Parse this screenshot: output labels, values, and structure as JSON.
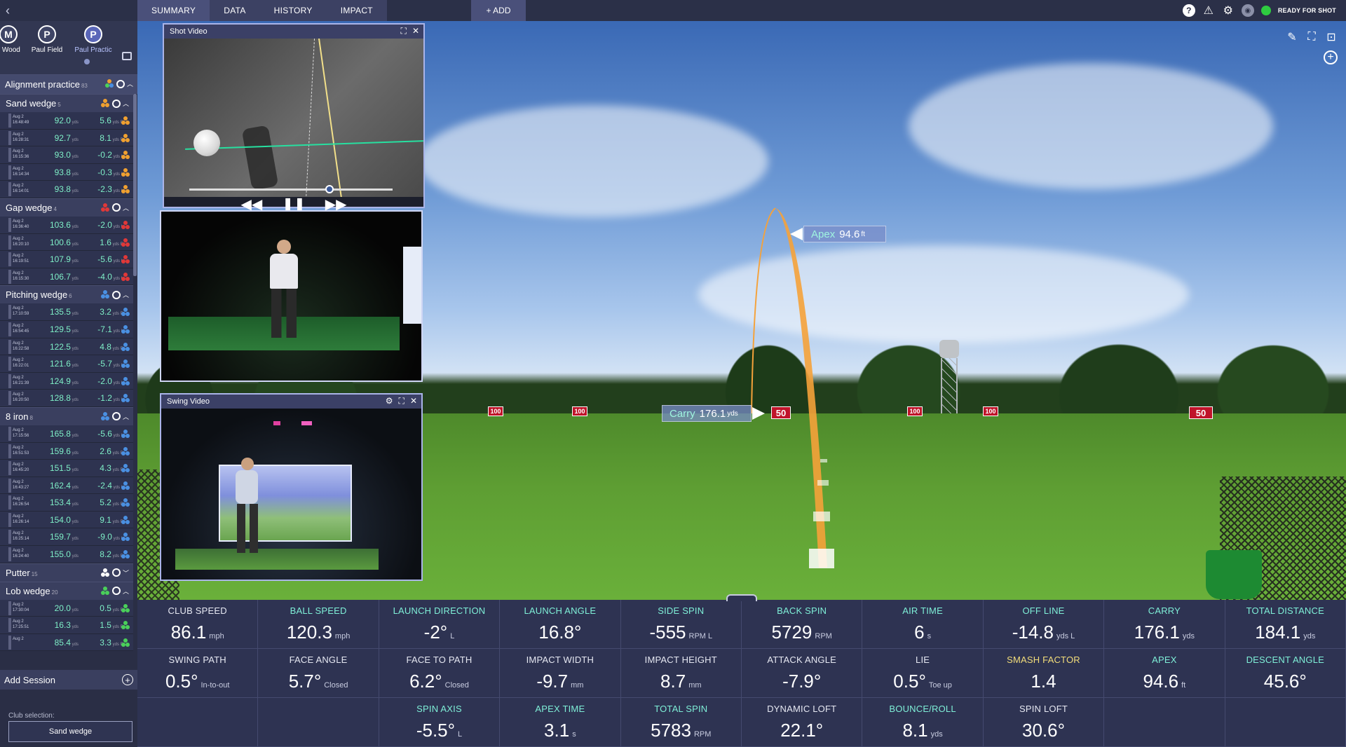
{
  "topbar": {
    "tabs": [
      "SUMMARY",
      "DATA",
      "HISTORY",
      "IMPACT"
    ],
    "add_label": "+ ADD",
    "status": "READY FOR SHOT"
  },
  "sidebar": {
    "profiles": [
      {
        "initial": "M",
        "name": "y Wood"
      },
      {
        "initial": "P",
        "name": "Paul Field"
      },
      {
        "initial": "P",
        "name": "Paul Practic"
      }
    ],
    "session_title": "Alignment practice",
    "session_count": "83",
    "groups": [
      {
        "name": "Sand wedge",
        "count": "5",
        "color": "#f0a030",
        "shots": [
          {
            "date": "Aug 2",
            "time": "16:48:49",
            "carry": "92.0",
            "dev": "5.6",
            "dir": "R"
          },
          {
            "date": "Aug 2",
            "time": "16:28:31",
            "carry": "92.7",
            "dev": "8.1",
            "dir": "R"
          },
          {
            "date": "Aug 2",
            "time": "16:15:36",
            "carry": "93.0",
            "dev": "-0.2",
            "dir": "L"
          },
          {
            "date": "Aug 2",
            "time": "16:14:34",
            "carry": "93.8",
            "dev": "-0.3",
            "dir": "L"
          },
          {
            "date": "Aug 2",
            "time": "16:14:01",
            "carry": "93.8",
            "dev": "-2.3",
            "dir": "L"
          }
        ]
      },
      {
        "name": "Gap wedge",
        "count": "4",
        "color": "#e03838",
        "shots": [
          {
            "date": "Aug 2",
            "time": "16:36:40",
            "carry": "103.6",
            "dev": "-2.0",
            "dir": "L"
          },
          {
            "date": "Aug 2",
            "time": "16:20:10",
            "carry": "100.6",
            "dev": "1.6",
            "dir": "R"
          },
          {
            "date": "Aug 2",
            "time": "16:19:51",
            "carry": "107.9",
            "dev": "-5.6",
            "dir": "L"
          },
          {
            "date": "Aug 2",
            "time": "16:15:30",
            "carry": "106.7",
            "dev": "-4.0",
            "dir": "L"
          }
        ]
      },
      {
        "name": "Pitching wedge",
        "count": "6",
        "color": "#4a90e2",
        "shots": [
          {
            "date": "Aug 2",
            "time": "17:10:59",
            "carry": "135.5",
            "dev": "3.2",
            "dir": "R"
          },
          {
            "date": "Aug 2",
            "time": "16:54:45",
            "carry": "129.5",
            "dev": "-7.1",
            "dir": "L"
          },
          {
            "date": "Aug 2",
            "time": "16:22:58",
            "carry": "122.5",
            "dev": "4.8",
            "dir": "R"
          },
          {
            "date": "Aug 2",
            "time": "16:22:01",
            "carry": "121.6",
            "dev": "-5.7",
            "dir": "L"
          },
          {
            "date": "Aug 2",
            "time": "16:21:39",
            "carry": "124.9",
            "dev": "-2.0",
            "dir": "L"
          },
          {
            "date": "Aug 2",
            "time": "16:20:50",
            "carry": "128.8",
            "dev": "-1.2",
            "dir": "L"
          }
        ]
      },
      {
        "name": "8 iron",
        "count": "8",
        "color": "#4a90e2",
        "shots": [
          {
            "date": "Aug 2",
            "time": "17:15:56",
            "carry": "165.8",
            "dev": "-5.6",
            "dir": "L"
          },
          {
            "date": "Aug 2",
            "time": "16:51:53",
            "carry": "159.6",
            "dev": "2.6",
            "dir": "R"
          },
          {
            "date": "Aug 2",
            "time": "16:45:20",
            "carry": "151.5",
            "dev": "4.3",
            "dir": "R"
          },
          {
            "date": "Aug 2",
            "time": "16:43:27",
            "carry": "162.4",
            "dev": "-2.4",
            "dir": "L"
          },
          {
            "date": "Aug 2",
            "time": "16:26:54",
            "carry": "153.4",
            "dev": "5.2",
            "dir": "R"
          },
          {
            "date": "Aug 2",
            "time": "16:26:14",
            "carry": "154.0",
            "dev": "9.1",
            "dir": "R"
          },
          {
            "date": "Aug 2",
            "time": "16:25:14",
            "carry": "159.7",
            "dev": "-9.0",
            "dir": "L"
          },
          {
            "date": "Aug 2",
            "time": "16:24:40",
            "carry": "155.0",
            "dev": "8.2",
            "dir": "R"
          }
        ]
      },
      {
        "name": "Putter",
        "count": "15",
        "color": "#ffffff",
        "shots": []
      },
      {
        "name": "Lob wedge",
        "count": "20",
        "color": "#4ad05a",
        "shots": [
          {
            "date": "Aug 2",
            "time": "17:30:04",
            "carry": "20.0",
            "dev": "0.5",
            "dir": "R"
          },
          {
            "date": "Aug 2",
            "time": "17:25:51",
            "carry": "16.3",
            "dev": "1.5",
            "dir": "R"
          },
          {
            "date": "Aug 2",
            "time": "",
            "carry": "85.4",
            "dev": "3.3",
            "dir": "R"
          }
        ]
      }
    ],
    "add_session": "Add Session",
    "club_selection_label": "Club selection:",
    "club_selection_value": "Sand wedge"
  },
  "video": {
    "shot_title": "Shot Video",
    "swing_title": "Swing Video"
  },
  "scene": {
    "apex_label": "Apex",
    "apex_value": "94.6",
    "apex_unit": "ft",
    "carry_label": "Carry",
    "carry_value": "176.1",
    "carry_unit": "yds",
    "signs": [
      "100",
      "100",
      "50",
      "100",
      "100",
      "50"
    ]
  },
  "stats": [
    {
      "label": "CLUB SPEED",
      "value": "86.1",
      "unit": "mph",
      "style": ""
    },
    {
      "label": "BALL SPEED",
      "value": "120.3",
      "unit": "mph",
      "style": "hl"
    },
    {
      "label": "LAUNCH DIRECTION",
      "value": "-2°",
      "unit": "L",
      "style": "hl"
    },
    {
      "label": "LAUNCH ANGLE",
      "value": "16.8°",
      "unit": "",
      "style": "hl"
    },
    {
      "label": "SIDE SPIN",
      "value": "-555",
      "unit": "RPM L",
      "style": "hl"
    },
    {
      "label": "BACK SPIN",
      "value": "5729",
      "unit": "RPM",
      "style": "hl"
    },
    {
      "label": "AIR TIME",
      "value": "6",
      "unit": "s",
      "style": "hl"
    },
    {
      "label": "OFF LINE",
      "value": "-14.8",
      "unit": "yds L",
      "style": "hl"
    },
    {
      "label": "CARRY",
      "value": "176.1",
      "unit": "yds",
      "style": "hl"
    },
    {
      "label": "TOTAL DISTANCE",
      "value": "184.1",
      "unit": "yds",
      "style": "hl"
    },
    {
      "label": "SWING PATH",
      "value": "0.5°",
      "unit": "In-to-out",
      "style": ""
    },
    {
      "label": "FACE ANGLE",
      "value": "5.7°",
      "unit": "Closed",
      "style": ""
    },
    {
      "label": "FACE TO PATH",
      "value": "6.2°",
      "unit": "Closed",
      "style": ""
    },
    {
      "label": "IMPACT WIDTH",
      "value": "-9.7",
      "unit": "mm",
      "style": ""
    },
    {
      "label": "IMPACT HEIGHT",
      "value": "8.7",
      "unit": "mm",
      "style": ""
    },
    {
      "label": "ATTACK ANGLE",
      "value": "-7.9°",
      "unit": "",
      "style": ""
    },
    {
      "label": "LIE",
      "value": "0.5°",
      "unit": "Toe up",
      "style": ""
    },
    {
      "label": "SMASH FACTOR",
      "value": "1.4",
      "unit": "",
      "style": "yel"
    },
    {
      "label": "APEX",
      "value": "94.6",
      "unit": "ft",
      "style": "hl"
    },
    {
      "label": "DESCENT ANGLE",
      "value": "45.6°",
      "unit": "",
      "style": "hl"
    },
    {
      "label": "",
      "value": "",
      "unit": "",
      "style": ""
    },
    {
      "label": "",
      "value": "",
      "unit": "",
      "style": ""
    },
    {
      "label": "SPIN AXIS",
      "value": "-5.5°",
      "unit": "L",
      "style": "hl"
    },
    {
      "label": "APEX TIME",
      "value": "3.1",
      "unit": "s",
      "style": "hl"
    },
    {
      "label": "TOTAL SPIN",
      "value": "5783",
      "unit": "RPM",
      "style": "hl"
    },
    {
      "label": "DYNAMIC LOFT",
      "value": "22.1°",
      "unit": "",
      "style": ""
    },
    {
      "label": "BOUNCE/ROLL",
      "value": "8.1",
      "unit": "yds",
      "style": "hl"
    },
    {
      "label": "SPIN LOFT",
      "value": "30.6°",
      "unit": "",
      "style": ""
    },
    {
      "label": "",
      "value": "",
      "unit": "",
      "style": ""
    },
    {
      "label": "",
      "value": "",
      "unit": "",
      "style": ""
    }
  ],
  "colors": {
    "accent": "#7ff0d8",
    "status": "#2ecc40",
    "trajectory": "#f5a23a"
  }
}
